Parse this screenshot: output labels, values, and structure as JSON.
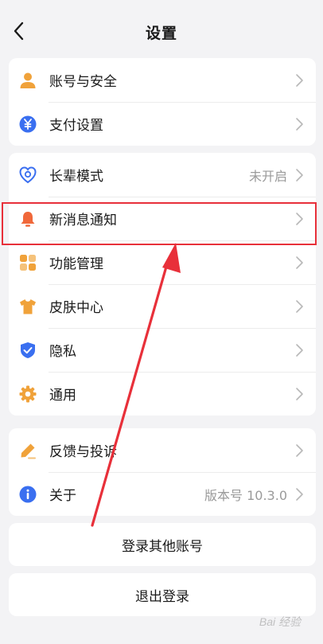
{
  "header": {
    "title": "设置",
    "back_icon": "back-arrow-icon"
  },
  "groups": [
    {
      "items": [
        {
          "label": "账号与安全",
          "icon": "user-icon",
          "color": "#f0a23a"
        },
        {
          "label": "支付设置",
          "icon": "yuan-coin-icon",
          "color": "#3a6ff0"
        }
      ]
    },
    {
      "items": [
        {
          "label": "长辈模式",
          "value": "未开启",
          "icon": "heart-shield-icon",
          "color": "#3a6ff0"
        },
        {
          "label": "新消息通知",
          "icon": "bell-icon",
          "color": "#f0683a"
        },
        {
          "label": "功能管理",
          "icon": "grid-icon",
          "color": "#f0a23a"
        },
        {
          "label": "皮肤中心",
          "icon": "tshirt-icon",
          "color": "#f0a23a"
        },
        {
          "label": "隐私",
          "icon": "shield-check-icon",
          "color": "#3a6ff0"
        },
        {
          "label": "通用",
          "icon": "gear-icon",
          "color": "#f0a23a"
        }
      ]
    },
    {
      "items": [
        {
          "label": "反馈与投诉",
          "icon": "pencil-icon",
          "color": "#f0a23a"
        },
        {
          "label": "关于",
          "value": "版本号 10.3.0",
          "icon": "info-icon",
          "color": "#3a6ff0"
        }
      ]
    }
  ],
  "actions": {
    "switch_account": "登录其他账号",
    "logout": "退出登录"
  },
  "annotation": {
    "highlight_color": "#e8303a"
  },
  "watermark": "Bai 经验"
}
